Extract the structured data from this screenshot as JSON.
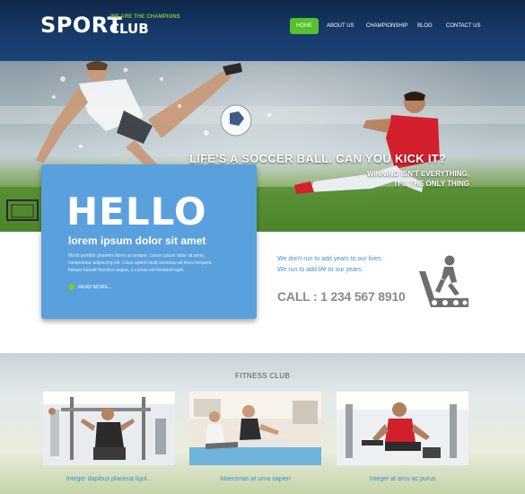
{
  "brand": {
    "name_part1": "SPORT",
    "name_part2": "CLUB",
    "tagline": "WE ARE THE CHAMPIONS"
  },
  "nav": {
    "items": [
      {
        "label": "HOME",
        "active": true
      },
      {
        "label": "ABOUT US",
        "active": false
      },
      {
        "label": "CHAMPIONSHIP",
        "active": false
      },
      {
        "label": "BLOG",
        "active": false
      },
      {
        "label": "CONTACT US",
        "active": false
      }
    ]
  },
  "hero": {
    "headline": "LIFE'S A SOCCER BALL. CAN YOU KICK IT?",
    "subline1": "WINNING ISN'T EVERYTHING,",
    "subline2": "IT'S THE ONLY THING"
  },
  "hello_card": {
    "title": "HELLO",
    "subtitle": "lorem ipsum dolor sit amet",
    "body": "Morbi porttitor pharetra libero at semper. Lorem ipsum dolor sit amet, consectetur adipiscing elit. Class aptent taciti sociosqu ad litora torquent. Integer blandit faucibus augue, a cursus est tincidunt eget.",
    "read_more": "READ MORE..."
  },
  "info": {
    "line1": "We don't run to add years to our lives.",
    "line2": "We run to add life to our years.",
    "phone": "CALL : 1 234 567 8910"
  },
  "fitness": {
    "title": "FITNESS CLUB",
    "items": [
      {
        "caption": "Integer dapibus placerat ligul..."
      },
      {
        "caption": "Maecenas at urna sapien"
      },
      {
        "caption": "Integer at arcu ac purus"
      }
    ]
  },
  "colors": {
    "header_bg": "#173a6a",
    "accent_green": "#55c22c",
    "card_blue": "#5aa0dd",
    "link_blue": "#3f8fd2"
  },
  "icons": [
    "treadmill-runner-icon",
    "read-more-dot-icon"
  ]
}
